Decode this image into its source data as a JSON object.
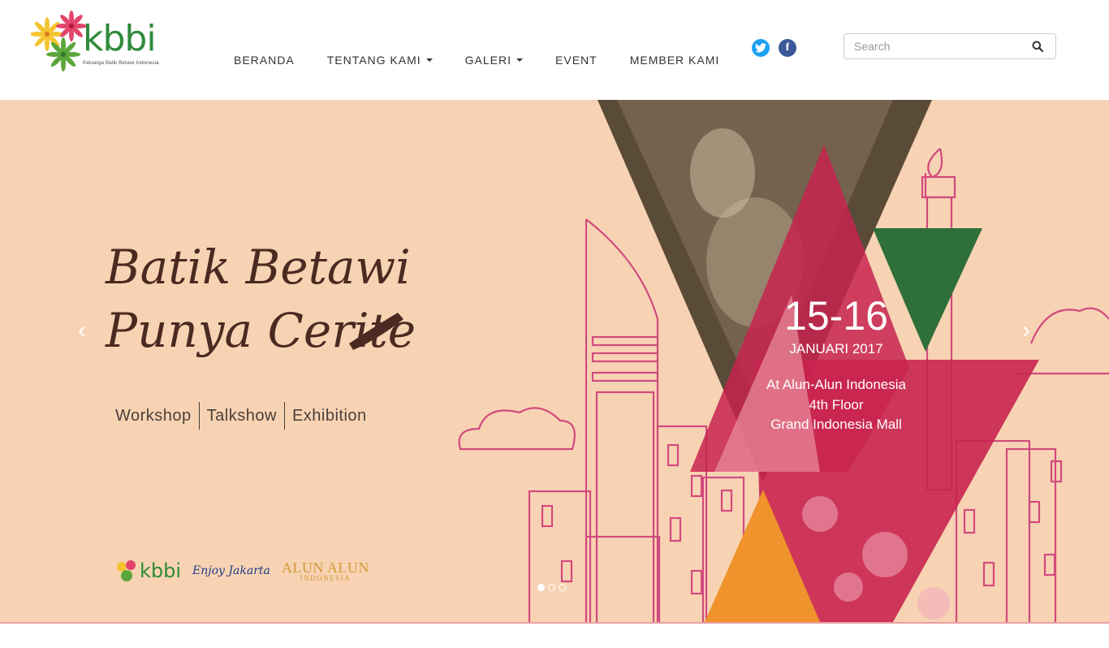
{
  "header": {
    "logo_text": "kbbi",
    "logo_tagline": "Keluarga Batik Betawi Indonesia"
  },
  "nav": {
    "items": [
      {
        "label": "BERANDA",
        "dropdown": false
      },
      {
        "label": "TENTANG KAMI",
        "dropdown": true
      },
      {
        "label": "GALERI",
        "dropdown": true
      },
      {
        "label": "EVENT",
        "dropdown": false
      },
      {
        "label": "MEMBER KAMI",
        "dropdown": false
      }
    ]
  },
  "social": {
    "twitter_glyph": "t",
    "facebook_glyph": "f"
  },
  "search": {
    "placeholder": "Search",
    "value": ""
  },
  "banner": {
    "headline_line1": "Batik Betawi",
    "headline_line2": "Punya Cerite",
    "services": [
      "Workshop",
      "Talkshow",
      "Exhibition"
    ],
    "event_date": "15-16",
    "event_month": "JANUARI 2017",
    "event_location_1": "At Alun-Alun Indonesia",
    "event_location_2": "4th Floor",
    "event_location_3": "Grand Indonesia Mall",
    "partners": {
      "kbbi": "kbbi",
      "enjoy": "Enjoy Jakarta",
      "alun_alun": "ALUN ALUN",
      "alun_alun_sub": "INDONESIA"
    },
    "prev_arrow": "‹",
    "next_arrow": "›",
    "slide_count": 3,
    "active_slide": 1
  },
  "colors": {
    "banner_bg": "#f7d3b3",
    "magenta": "#c8234f",
    "green": "#2e6f3a",
    "orange": "#f0932c",
    "brown_text": "#4b2a22"
  }
}
